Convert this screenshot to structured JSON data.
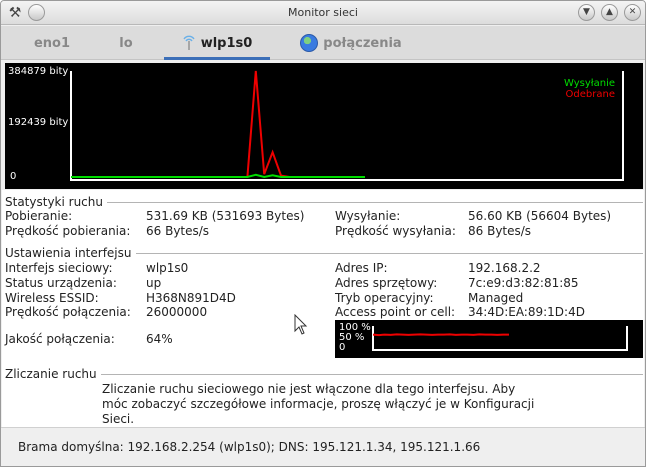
{
  "window": {
    "title": "Monitor sieci"
  },
  "tabs": [
    {
      "label": "eno1"
    },
    {
      "label": "lo"
    },
    {
      "label": "wlp1s0"
    },
    {
      "label": "połączenia"
    }
  ],
  "graph": {
    "y_labels": {
      "top": "384879 bity",
      "mid": "192439 bity",
      "zero": "0"
    },
    "legend": {
      "send": "Wysyłanie",
      "recv": "Odebrane"
    },
    "colors": {
      "send": "#00dd00",
      "recv": "#ee0000",
      "axis": "#ffffff"
    },
    "chart_data": {
      "type": "line",
      "ylim": [
        0,
        384879
      ],
      "series": [
        {
          "name": "Wysyłanie",
          "values": [
            0,
            0,
            0,
            0,
            0,
            0,
            0,
            0,
            0,
            0,
            0,
            0,
            0,
            0,
            0,
            0,
            0,
            0,
            0,
            0,
            0,
            0,
            8000,
            0,
            6000,
            0,
            0,
            0,
            0,
            0,
            0,
            0,
            0,
            0,
            0,
            0
          ]
        },
        {
          "name": "Odebrane",
          "values": [
            0,
            0,
            0,
            0,
            0,
            0,
            0,
            0,
            0,
            0,
            0,
            0,
            0,
            0,
            0,
            0,
            0,
            0,
            0,
            0,
            0,
            0,
            384879,
            10000,
            90000,
            5000,
            0,
            0,
            0,
            0,
            0,
            0,
            0,
            0,
            0,
            0
          ]
        }
      ]
    }
  },
  "stats": {
    "title": "Statystyki ruchu",
    "download_label": "Pobieranie:",
    "download_value": "531.69 KB (531693 Bytes)",
    "upload_label": "Wysyłanie:",
    "upload_value": "56.60 KB (56604 Bytes)",
    "dl_speed_label": "Prędkość pobierania:",
    "dl_speed_value": "66 Bytes/s",
    "ul_speed_label": "Prędkość wysyłania:",
    "ul_speed_value": "86 Bytes/s"
  },
  "iface": {
    "title": "Ustawienia interfejsu",
    "rows_left": [
      {
        "label": "Interfejs sieciowy:",
        "value": "wlp1s0"
      },
      {
        "label": "Status urządzenia:",
        "value": "up"
      },
      {
        "label": "Wireless ESSID:",
        "value": "H368N891D4D"
      },
      {
        "label": "Prędkość połączenia:",
        "value": "26000000"
      }
    ],
    "rows_right": [
      {
        "label": "Adres IP:",
        "value": "192.168.2.2"
      },
      {
        "label": "Adres sprzętowy:",
        "value": "7c:e9:d3:82:81:85"
      },
      {
        "label": "Tryb operacyjny:",
        "value": "Managed"
      },
      {
        "label": "Access point or cell:",
        "value": "34:4D:EA:89:1D:4D"
      }
    ],
    "quality_label": "Jakość połączenia:",
    "quality_value": "64%",
    "quality_graph": {
      "labels": {
        "top": "100 %",
        "mid": "50 %",
        "zero": "0"
      },
      "color": "#ee0000",
      "values": [
        64,
        62,
        64,
        63,
        65,
        64,
        63,
        64,
        65,
        64,
        63,
        64,
        64,
        65,
        63,
        64,
        64,
        63,
        65,
        64,
        64,
        63,
        64,
        64
      ]
    }
  },
  "counting": {
    "title": "Zliczanie ruchu",
    "message": [
      "Zliczanie ruchu sieciowego nie jest włączone dla tego interfejsu. Aby",
      "móc zobaczyć szczegółowe informacje, proszę włączyć je w Konfiguracji",
      "Sieci."
    ]
  },
  "status": {
    "text": "Brama domyślna: 192.168.2.254 (wlp1s0); DNS: 195.121.1.34, 195.121.1.66"
  }
}
